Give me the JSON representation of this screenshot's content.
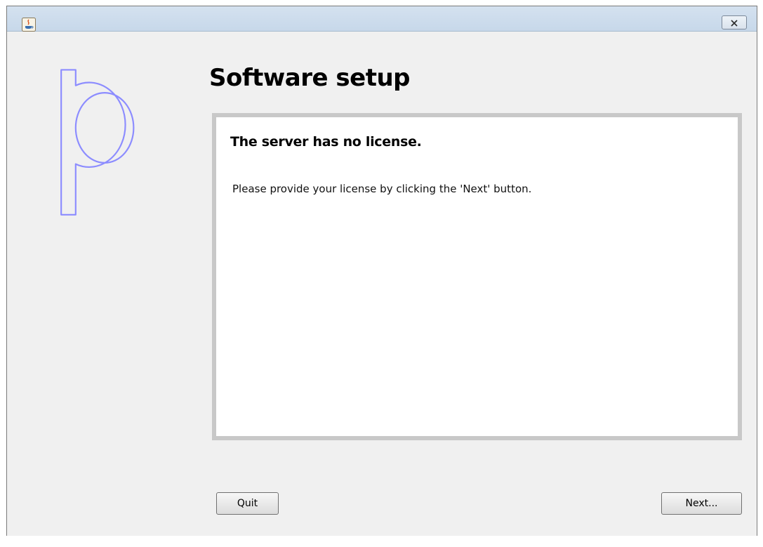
{
  "window": {
    "icons": {
      "app_icon": "java-icon",
      "close": "close-icon"
    }
  },
  "logo": {
    "letter": "p",
    "color": "#8c8cff"
  },
  "page_title": "Software setup",
  "message": {
    "heading": "The server has no license.",
    "body": "Please provide your license by clicking the 'Next' button."
  },
  "buttons": {
    "quit_label": "Quit",
    "next_label": "Next..."
  },
  "colors": {
    "background": "#f0f0f0",
    "panel_border": "#c8c8c8",
    "titlebar": "#c7d8ea"
  }
}
